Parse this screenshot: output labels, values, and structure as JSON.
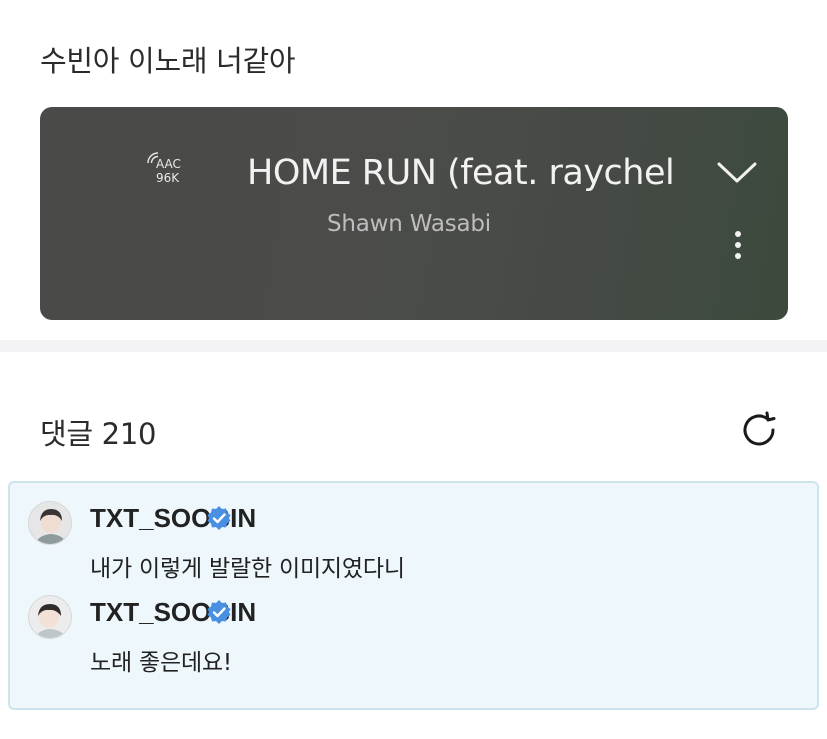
{
  "post": {
    "text": "수빈아 이노래 너같아"
  },
  "player": {
    "codec": "AAC",
    "bitrate": "96K",
    "title": "HOME RUN (feat. raychel",
    "artist": "Shawn Wasabi",
    "icons": {
      "collapse": "chevron-down-icon",
      "more": "more-vertical-icon",
      "quality": "signal-waves-icon"
    }
  },
  "comments": {
    "header": "댓글 210",
    "refresh_icon": "refresh-icon",
    "items": [
      {
        "username": "TXT_SOOBIN",
        "verified": true,
        "text": "내가 이렇게 발랄한 이미지였다니"
      },
      {
        "username": "TXT_SOOBIN",
        "verified": true,
        "text": "노래 좋은데요!"
      }
    ]
  },
  "colors": {
    "verified": "#4a90e2",
    "comment_highlight_bg": "#eef7fb",
    "comment_highlight_border": "#cde3ee",
    "player_bg": "#4a4a48"
  }
}
